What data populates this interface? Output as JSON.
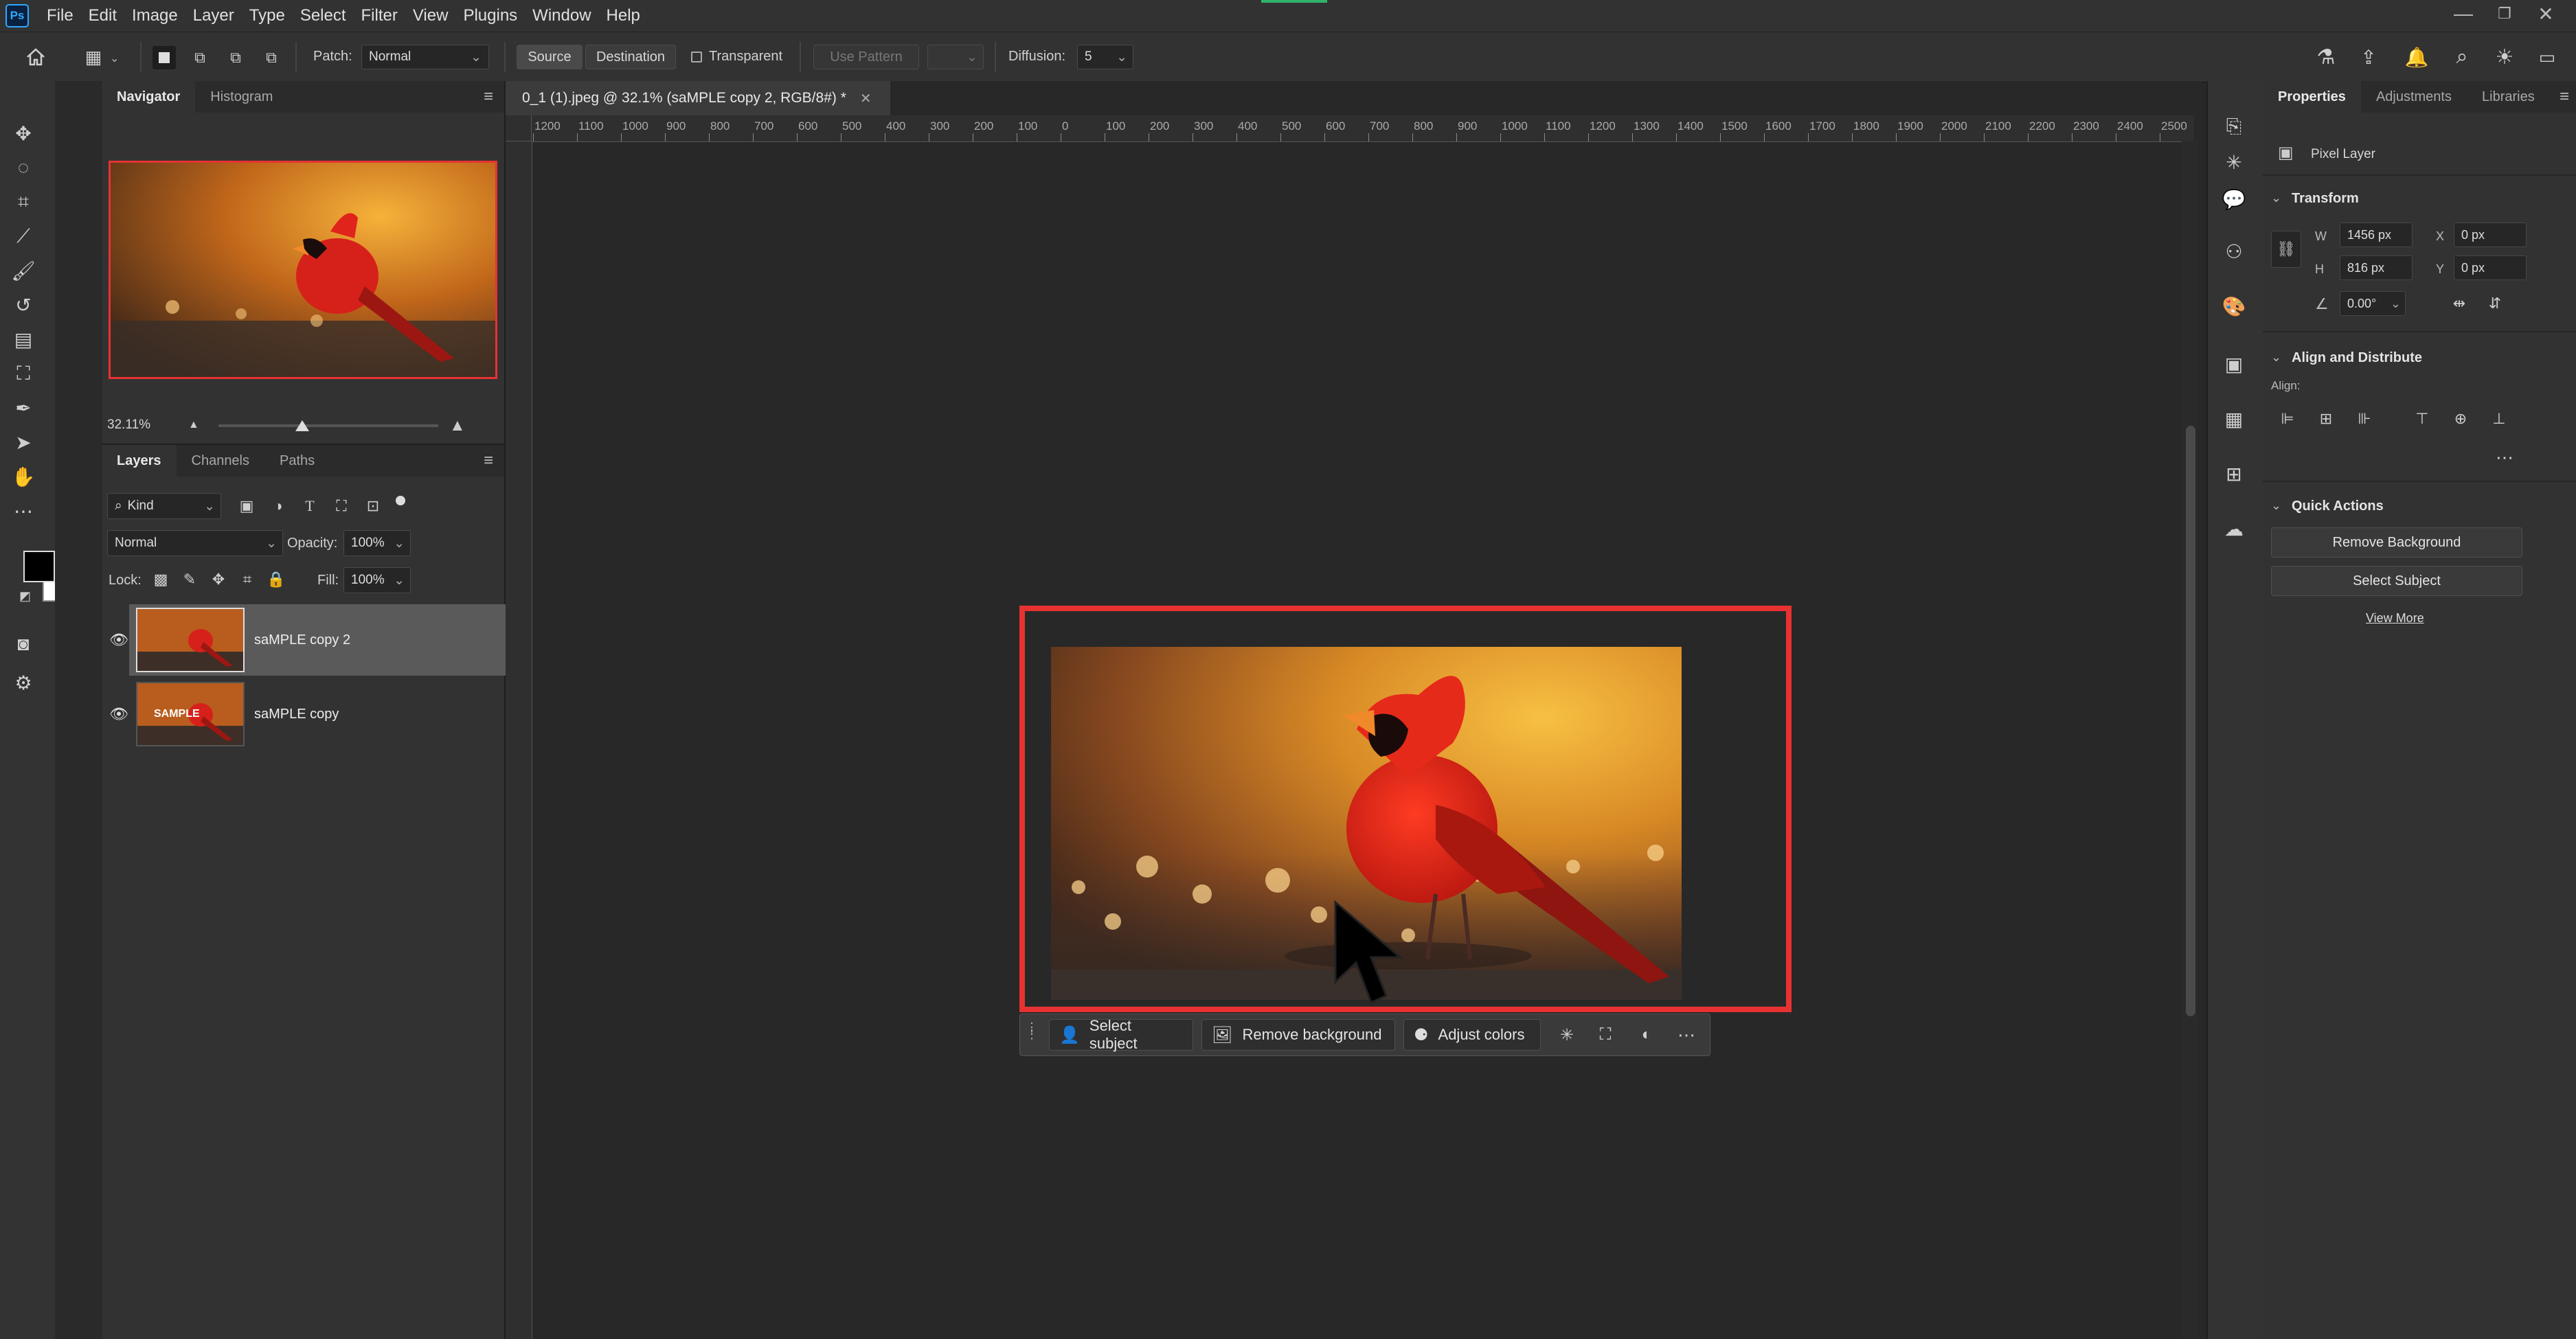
{
  "menubar": {
    "logo": "Ps",
    "items": [
      "File",
      "Edit",
      "Image",
      "Layer",
      "Type",
      "Select",
      "Filter",
      "View",
      "Plugins",
      "Window",
      "Help"
    ]
  },
  "options": {
    "patch_label": "Patch:",
    "patch_mode": "Normal",
    "source_label": "Source",
    "destination_label": "Destination",
    "transparent_label": "Transparent",
    "use_pattern_label": "Use Pattern",
    "diffusion_label": "Diffusion:",
    "diffusion_value": "5"
  },
  "navigator": {
    "tabs": [
      "Navigator",
      "Histogram"
    ],
    "zoom": "32.11%"
  },
  "layers_panel": {
    "tabs": [
      "Layers",
      "Channels",
      "Paths"
    ],
    "filter_kind": "Kind",
    "blend_mode": "Normal",
    "opacity_label": "Opacity:",
    "opacity_value": "100%",
    "lock_label": "Lock:",
    "fill_label": "Fill:",
    "fill_value": "100%",
    "layers": [
      {
        "name": "saMPLE copy 2",
        "selected": true,
        "thumb_text": ""
      },
      {
        "name": "saMPLE copy",
        "selected": false,
        "thumb_text": "SAMPLE"
      }
    ]
  },
  "document": {
    "tab_title": "0_1 (1).jpeg @ 32.1% (saMPLE copy 2, RGB/8#) *",
    "ruler_labels": [
      "1200",
      "1100",
      "1000",
      "900",
      "800",
      "700",
      "600",
      "500",
      "400",
      "300",
      "200",
      "100",
      "0",
      "100",
      "200",
      "300",
      "400",
      "500",
      "600",
      "700",
      "800",
      "900",
      "1000",
      "1100",
      "1200",
      "1300",
      "1400",
      "1500",
      "1600",
      "1700",
      "1800",
      "1900",
      "2000",
      "2100",
      "2200",
      "2300",
      "2400",
      "2500"
    ]
  },
  "contextual_bar": {
    "select_subject": "Select subject",
    "remove_background": "Remove background",
    "adjust_colors": "Adjust colors"
  },
  "properties": {
    "tabs": [
      "Properties",
      "Adjustments",
      "Libraries"
    ],
    "layer_type": "Pixel Layer",
    "transform_title": "Transform",
    "w_label": "W",
    "w_value": "1456 px",
    "h_label": "H",
    "h_value": "816 px",
    "x_label": "X",
    "x_value": "0 px",
    "y_label": "Y",
    "y_value": "0 px",
    "angle_value": "0.00°",
    "align_title": "Align and Distribute",
    "align_label": "Align:",
    "quick_actions_title": "Quick Actions",
    "remove_background_btn": "Remove Background",
    "select_subject_btn": "Select Subject",
    "view_more": "View More"
  },
  "colors": {
    "highlight_red": "#e83232",
    "accent_blue": "#31a8ff"
  }
}
